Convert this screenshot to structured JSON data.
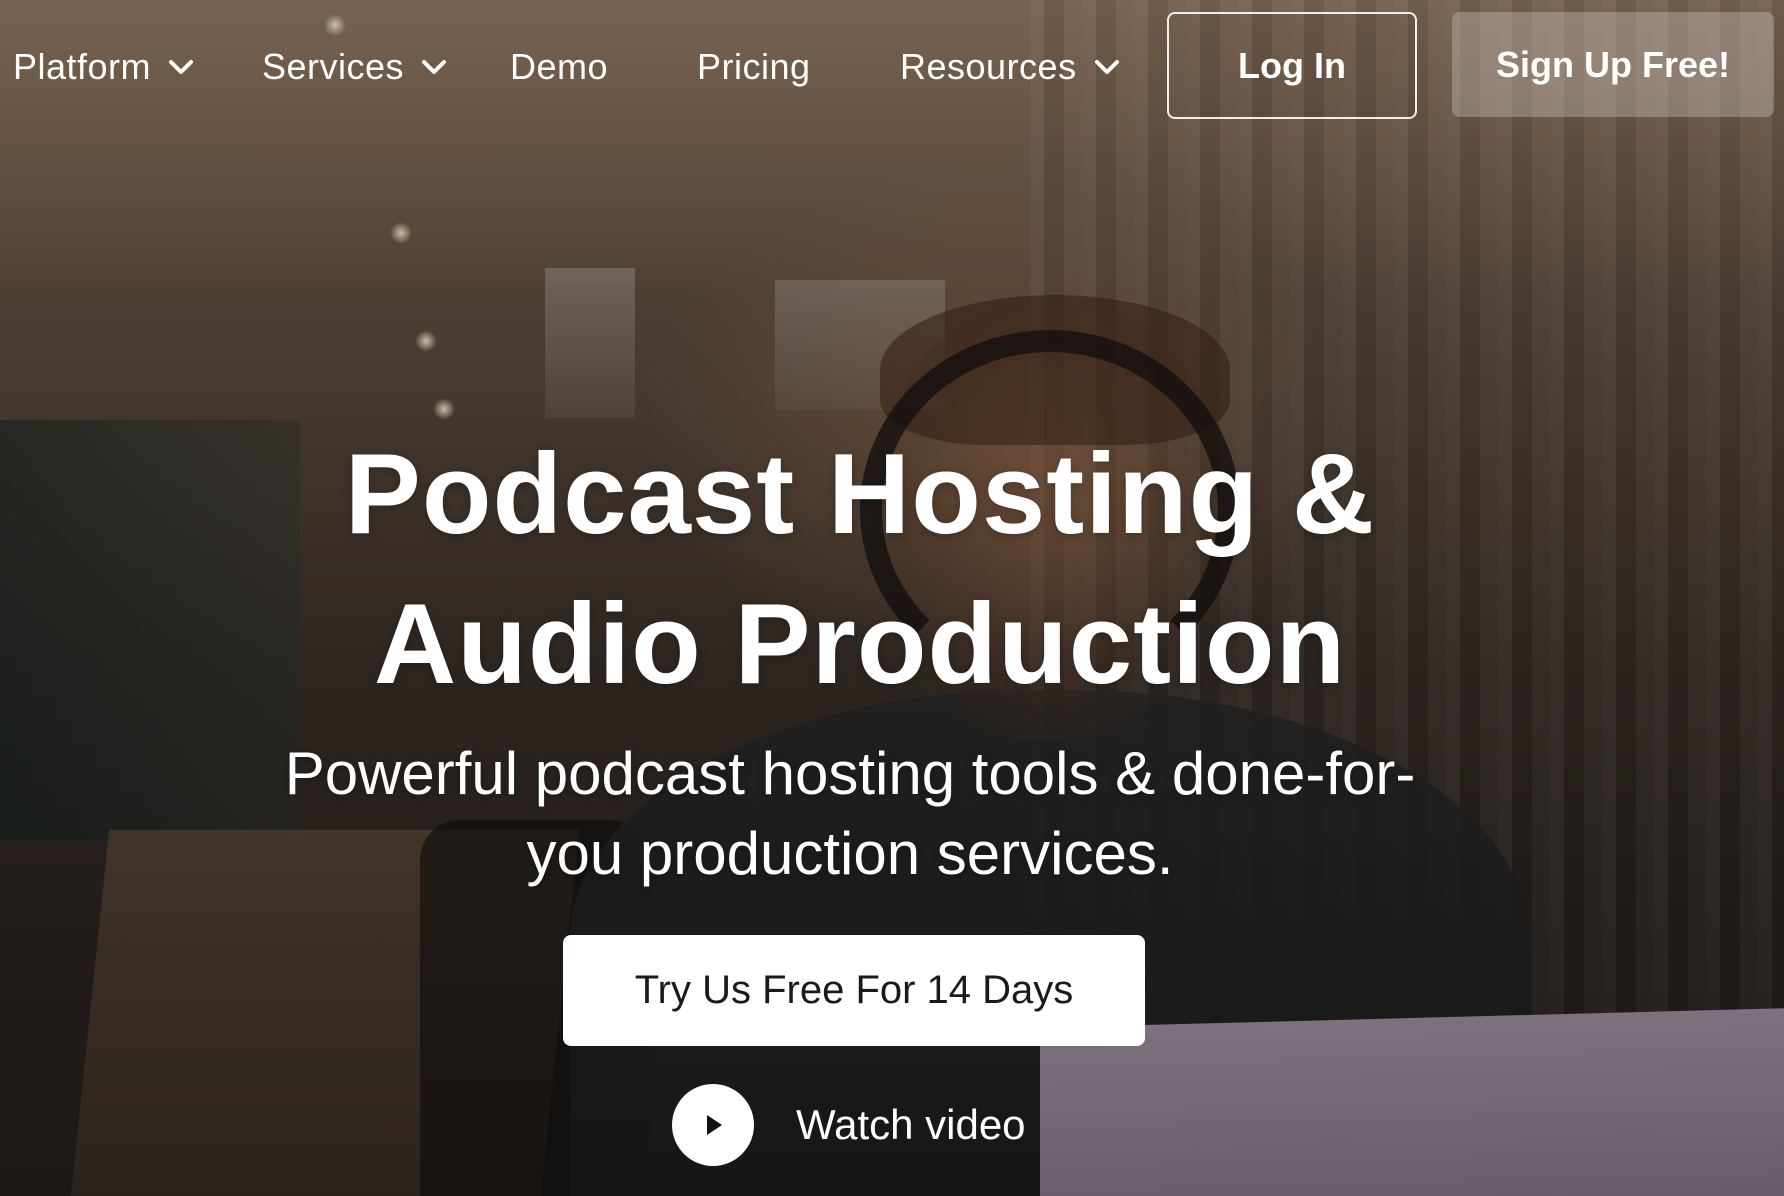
{
  "nav": {
    "items": [
      {
        "label": "Platform",
        "has_dropdown": true,
        "icon": "chevron-down-icon"
      },
      {
        "label": "Services",
        "has_dropdown": true,
        "icon": "chevron-down-icon"
      },
      {
        "label": "Demo",
        "has_dropdown": false
      },
      {
        "label": "Pricing",
        "has_dropdown": false
      },
      {
        "label": "Resources",
        "has_dropdown": true,
        "icon": "chevron-down-icon"
      }
    ],
    "login_label": "Log In",
    "signup_label": "Sign Up Free!"
  },
  "hero": {
    "headline_line1": "Podcast Hosting &",
    "headline_line2": "Audio Production",
    "subhead_line1": "Powerful podcast hosting tools & done-for-",
    "subhead_line2": "you production services.",
    "cta_label": "Try Us Free For 14 Days",
    "watch_label": "Watch video",
    "watch_icon": "play-icon",
    "background_image": "person-with-headphones-photo"
  },
  "colors": {
    "text": "#ffffff",
    "cta_background": "#ffffff",
    "cta_text": "#1a1a1a"
  }
}
